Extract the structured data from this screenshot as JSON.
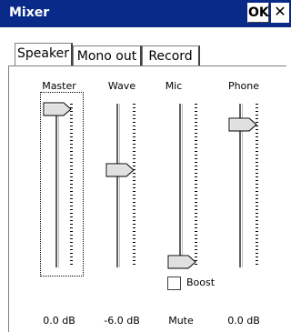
{
  "window": {
    "title": "Mixer",
    "ok_label": "OK",
    "close_glyph": "✕",
    "title_bar_color": "#0a2a8a"
  },
  "tabs": [
    {
      "label": "Speaker",
      "selected": true
    },
    {
      "label": "Mono out",
      "selected": false
    },
    {
      "label": "Record",
      "selected": false
    }
  ],
  "channels": [
    {
      "name": "Master",
      "readout": "0.0 dB",
      "level": 1.0,
      "focused": true
    },
    {
      "name": "Wave",
      "readout": "-6.0 dB",
      "level": 0.6,
      "focused": false
    },
    {
      "name": "Mic",
      "readout": "Mute",
      "level": 0.0,
      "focused": false
    },
    {
      "name": "Phone",
      "readout": "0.0 dB",
      "level": 0.9,
      "focused": false
    }
  ],
  "mic_boost": {
    "label": "Boost",
    "checked": false
  }
}
